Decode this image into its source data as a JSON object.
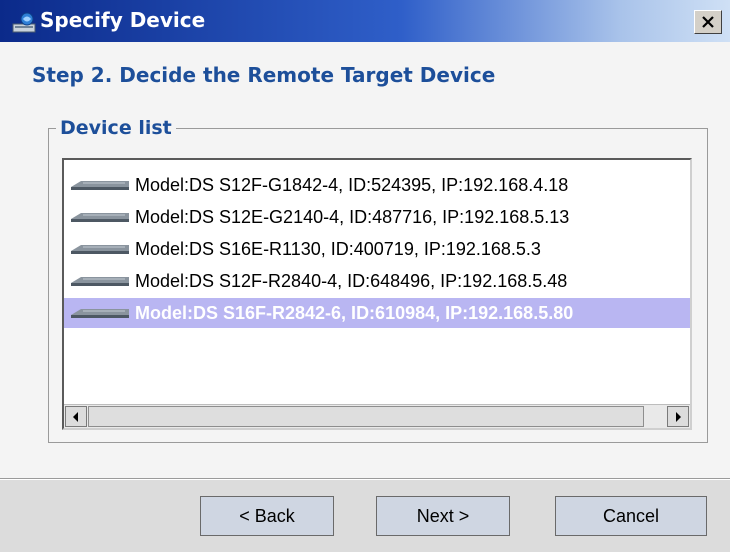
{
  "window": {
    "title": "Specify Device"
  },
  "step_title": "Step 2. Decide the Remote Target Device",
  "device_list": {
    "legend": "Device list",
    "items": [
      {
        "label": "Model:DS S12F-G1842-4, ID:524395, IP:192.168.4.18",
        "selected": false
      },
      {
        "label": "Model:DS S12E-G2140-4, ID:487716, IP:192.168.5.13",
        "selected": false
      },
      {
        "label": "Model:DS S16E-R1130, ID:400719, IP:192.168.5.3",
        "selected": false
      },
      {
        "label": "Model:DS S12F-R2840-4, ID:648496, IP:192.168.5.48",
        "selected": false
      },
      {
        "label": "Model:DS S16F-R2842-6, ID:610984, IP:192.168.5.80",
        "selected": true
      }
    ]
  },
  "buttons": {
    "back": "< Back",
    "next": "Next >",
    "cancel": "Cancel"
  },
  "icons": {
    "title": "device-window-icon",
    "close": "close-icon",
    "device": "network-device-icon",
    "scroll_left": "arrow-left-icon",
    "scroll_right": "arrow-right-icon"
  },
  "colors": {
    "title_bar_start": "#0b2a8a",
    "heading": "#1d4f9a",
    "selection": "#b9b6f2"
  }
}
